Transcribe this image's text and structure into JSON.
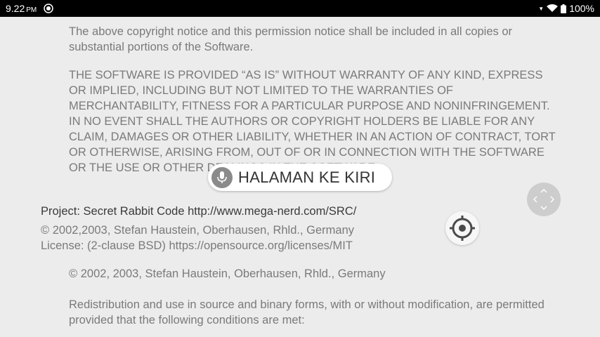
{
  "status_bar": {
    "time": "9.22",
    "ampm": "PM",
    "battery": "100%"
  },
  "document": {
    "para_copyright_notice": "The above copyright notice and this permission notice shall be included in all copies or substantial portions of the Software.",
    "para_warranty": "THE SOFTWARE IS PROVIDED “AS IS” WITHOUT WARRANTY OF ANY KIND, EXPRESS OR IMPLIED, INCLUDING BUT NOT LIMITED TO THE WARRANTIES OF MERCHANTABILITY, FITNESS FOR A PARTICULAR PURPOSE AND NONINFRINGEMENT. IN NO EVENT SHALL THE AUTHORS OR COPYRIGHT HOLDERS BE LIABLE FOR ANY CLAIM, DAMAGES OR OTHER LIABILITY, WHETHER IN AN ACTION OF CONTRACT, TORT OR OTHERWISE, ARISING FROM, OUT OF OR IN CONNECTION WITH THE SOFTWARE OR THE USE OR OTHER DEALINGS IN THE SOFTWARE.",
    "project_line": "Project: Secret Rabbit Code http://www.mega-nerd.com/SRC/",
    "project_copyright": "© 2002,2003, Stefan Haustein, Oberhausen, Rhld., Germany",
    "project_license": "License: (2-clause BSD) https://opensource.org/licenses/MIT",
    "license_copyright": "© 2002, 2003, Stefan Haustein, Oberhausen, Rhld., Germany",
    "license_redistribution": "Redistribution and use in source and binary forms, with or without modification, are permitted provided that the following conditions are met:"
  },
  "voice_command": {
    "text": "HALAMAN KE KIRI"
  },
  "colors": {
    "background": "#ececec",
    "body_text": "#7a7a7a",
    "project_text": "#3a3a3a",
    "status_bar": "#000000"
  }
}
